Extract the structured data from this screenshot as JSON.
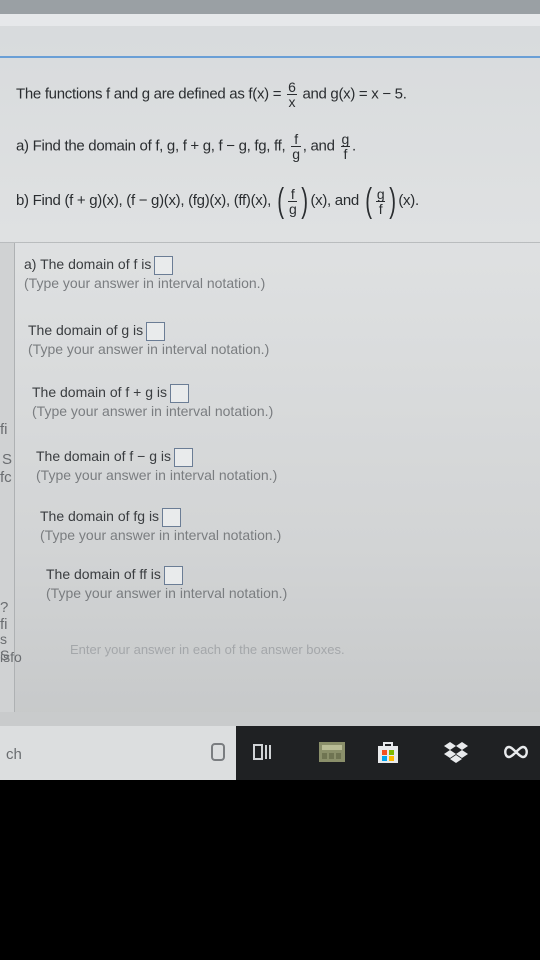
{
  "problem": {
    "intro_text": "The functions f and g are defined as f(x) =",
    "f_numerator": "6",
    "f_denominator": "x",
    "g_text": "and g(x) = x − 5.",
    "part_a_text": "a) Find the domain of f, g, f + g, f − g, fg, ff,",
    "part_a_frac1_num": "f",
    "part_a_frac1_den": "g",
    "part_a_comma": ",",
    "part_a_and": "and",
    "part_a_frac2_num": "g",
    "part_a_frac2_den": "f",
    "part_a_period": ".",
    "part_b_text": "b) Find (f + g)(x), (f − g)(x), (fg)(x), (ff)(x),",
    "part_b_frac1_num": "f",
    "part_b_frac1_den": "g",
    "part_b_x1": "(x), and",
    "part_b_frac2_num": "g",
    "part_b_frac2_den": "f",
    "part_b_x2": "(x)."
  },
  "answers": [
    {
      "label": "a) The domain of f is",
      "hint": "(Type your answer in interval notation.)"
    },
    {
      "label": "The domain of g is",
      "hint": "(Type your answer in interval notation.)"
    },
    {
      "label": "The domain of f + g is",
      "hint": "(Type your answer in interval notation.)"
    },
    {
      "label": "The domain of f − g is",
      "hint": "(Type your answer in interval notation.)"
    },
    {
      "label": "The domain of fg is",
      "hint": "(Type your answer in interval notation.)"
    },
    {
      "label": "The domain of ff is",
      "hint": "(Type your answer in interval notation.)"
    }
  ],
  "enter_text": "Enter your answer in each of the answer boxes.",
  "left_edge": [
    "fi",
    "S",
    "fc",
    "?fi",
    "s S",
    "isfo"
  ],
  "taskbar": {
    "search_text": "ch",
    "icons": [
      "cortana-icon",
      "task-view-icon",
      "calculator-icon",
      "store-icon",
      "dropbox-icon",
      "infinity-icon"
    ]
  }
}
